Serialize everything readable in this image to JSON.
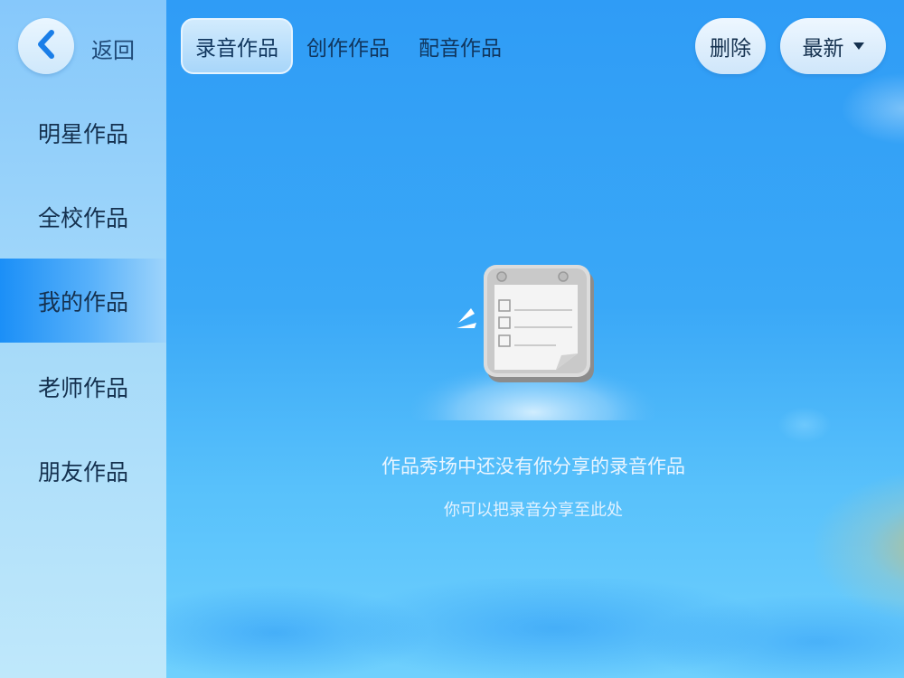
{
  "nav": {
    "back_label": "返回"
  },
  "sidebar": {
    "items": [
      {
        "label": "明星作品",
        "active": false
      },
      {
        "label": "全校作品",
        "active": false
      },
      {
        "label": "我的作品",
        "active": true
      },
      {
        "label": "老师作品",
        "active": false
      },
      {
        "label": "朋友作品",
        "active": false
      }
    ]
  },
  "tabs": [
    {
      "label": "录音作品",
      "active": true
    },
    {
      "label": "创作作品",
      "active": false
    },
    {
      "label": "配音作品",
      "active": false
    }
  ],
  "toolbar": {
    "delete_label": "删除",
    "sort_label": "最新"
  },
  "empty_state": {
    "message": "作品秀场中还没有你分享的录音作品",
    "hint": "你可以把录音分享至此处",
    "icon": "empty-checklist-icon"
  },
  "colors": {
    "accent": "#1b8ff7",
    "background": "#3aa8f7",
    "sidebar": "#a6daf9"
  }
}
